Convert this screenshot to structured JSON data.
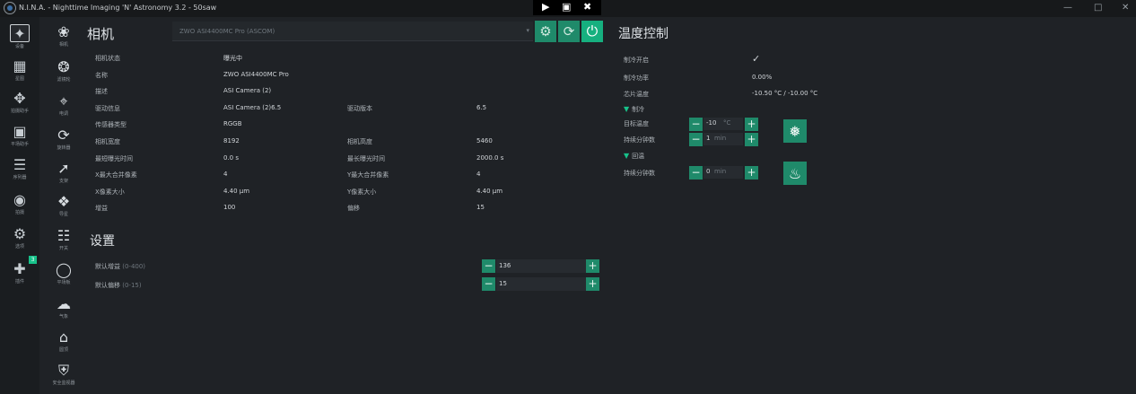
{
  "window": {
    "title": "N.I.N.A. - Nighttime Imaging 'N' Astronomy 3.2   -  50saw"
  },
  "overlay": {
    "icons": [
      "send-icon",
      "display-icon",
      "close-icon"
    ]
  },
  "main_nav": [
    {
      "label": "设备",
      "icon": "telescope-frame-icon",
      "active": true
    },
    {
      "label": "星图",
      "icon": "map-icon"
    },
    {
      "label": "拍摄助手",
      "icon": "crosshair-icon"
    },
    {
      "label": "平场助手",
      "icon": "flat-panel-icon"
    },
    {
      "label": "序列器",
      "icon": "list-stars-icon"
    },
    {
      "label": "拍摄",
      "icon": "target-icon"
    },
    {
      "label": "选项",
      "icon": "gears-icon"
    },
    {
      "label": "插件",
      "icon": "puzzle-icon",
      "badge": "3"
    }
  ],
  "sub_nav": [
    {
      "label": "相机",
      "icon": "camera-shutter-icon"
    },
    {
      "label": "滤镜轮",
      "icon": "filter-wheel-icon"
    },
    {
      "label": "电调",
      "icon": "focuser-icon"
    },
    {
      "label": "旋转器",
      "icon": "rotator-icon"
    },
    {
      "label": "支架",
      "icon": "telescope-icon"
    },
    {
      "label": "导星",
      "icon": "guider-icon"
    },
    {
      "label": "开关",
      "icon": "switch-sliders-icon"
    },
    {
      "label": "平场板",
      "icon": "lightbulb-icon"
    },
    {
      "label": "气象",
      "icon": "cloud-icon"
    },
    {
      "label": "圆顶",
      "icon": "dome-icon"
    },
    {
      "label": "安全监视器",
      "icon": "shield-icon"
    }
  ],
  "camera": {
    "title": "相机",
    "device": "ZWO ASI4400MC Pro (ASCOM)",
    "info": [
      {
        "l1": "相机状态",
        "v1": "曝光中",
        "l2": "",
        "v2": ""
      },
      {
        "l1": "名称",
        "v1": "ZWO ASI4400MC Pro",
        "l2": "",
        "v2": ""
      },
      {
        "l1": "描述",
        "v1": "ASI Camera (2)",
        "l2": "",
        "v2": ""
      },
      {
        "l1": "驱动信息",
        "v1": "ASI Camera (2)6.5",
        "l2": "驱动版本",
        "v2": "6.5"
      },
      {
        "l1": "传感器类型",
        "v1": "RGGB",
        "l2": "",
        "v2": ""
      },
      {
        "l1": "相机宽度",
        "v1": "8192",
        "l2": "相机高度",
        "v2": "5460"
      },
      {
        "l1": "最短曝光时间",
        "v1": "0.0 s",
        "l2": "最长曝光时间",
        "v2": "2000.0 s"
      },
      {
        "l1": "X最大合并像素",
        "v1": "4",
        "l2": "Y最大合并像素",
        "v2": "4"
      },
      {
        "l1": "X像素大小",
        "v1": "4.40 µm",
        "l2": "Y像素大小",
        "v2": "4.40 µm"
      },
      {
        "l1": "增益",
        "v1": "100",
        "l2": "偏移",
        "v2": "15"
      }
    ],
    "settings_title": "设置",
    "settings": [
      {
        "label": "默认增益",
        "range": "(0-400)",
        "value": "136"
      },
      {
        "label": "默认偏移",
        "range": "(0-15)",
        "value": "15"
      }
    ]
  },
  "temperature": {
    "title": "温度控制",
    "rows": [
      {
        "label": "制冷开启",
        "value": ""
      },
      {
        "label": "制冷功率",
        "value": "0.00%"
      },
      {
        "label": "芯片温度",
        "value": "-10.50 °C /  -10.00 °C"
      }
    ],
    "cooling": {
      "header": "制冷",
      "target_label": "目标温度",
      "target_value": "-10",
      "target_unit": "°C",
      "duration_label": "持续分钟数",
      "duration_value": "1",
      "duration_unit": "min"
    },
    "warming": {
      "header": "回温",
      "duration_label": "持续分钟数",
      "duration_value": "0",
      "duration_unit": "min"
    },
    "colors": {
      "accent": "#1f8a6a",
      "accent_bright": "#16b07f"
    }
  }
}
